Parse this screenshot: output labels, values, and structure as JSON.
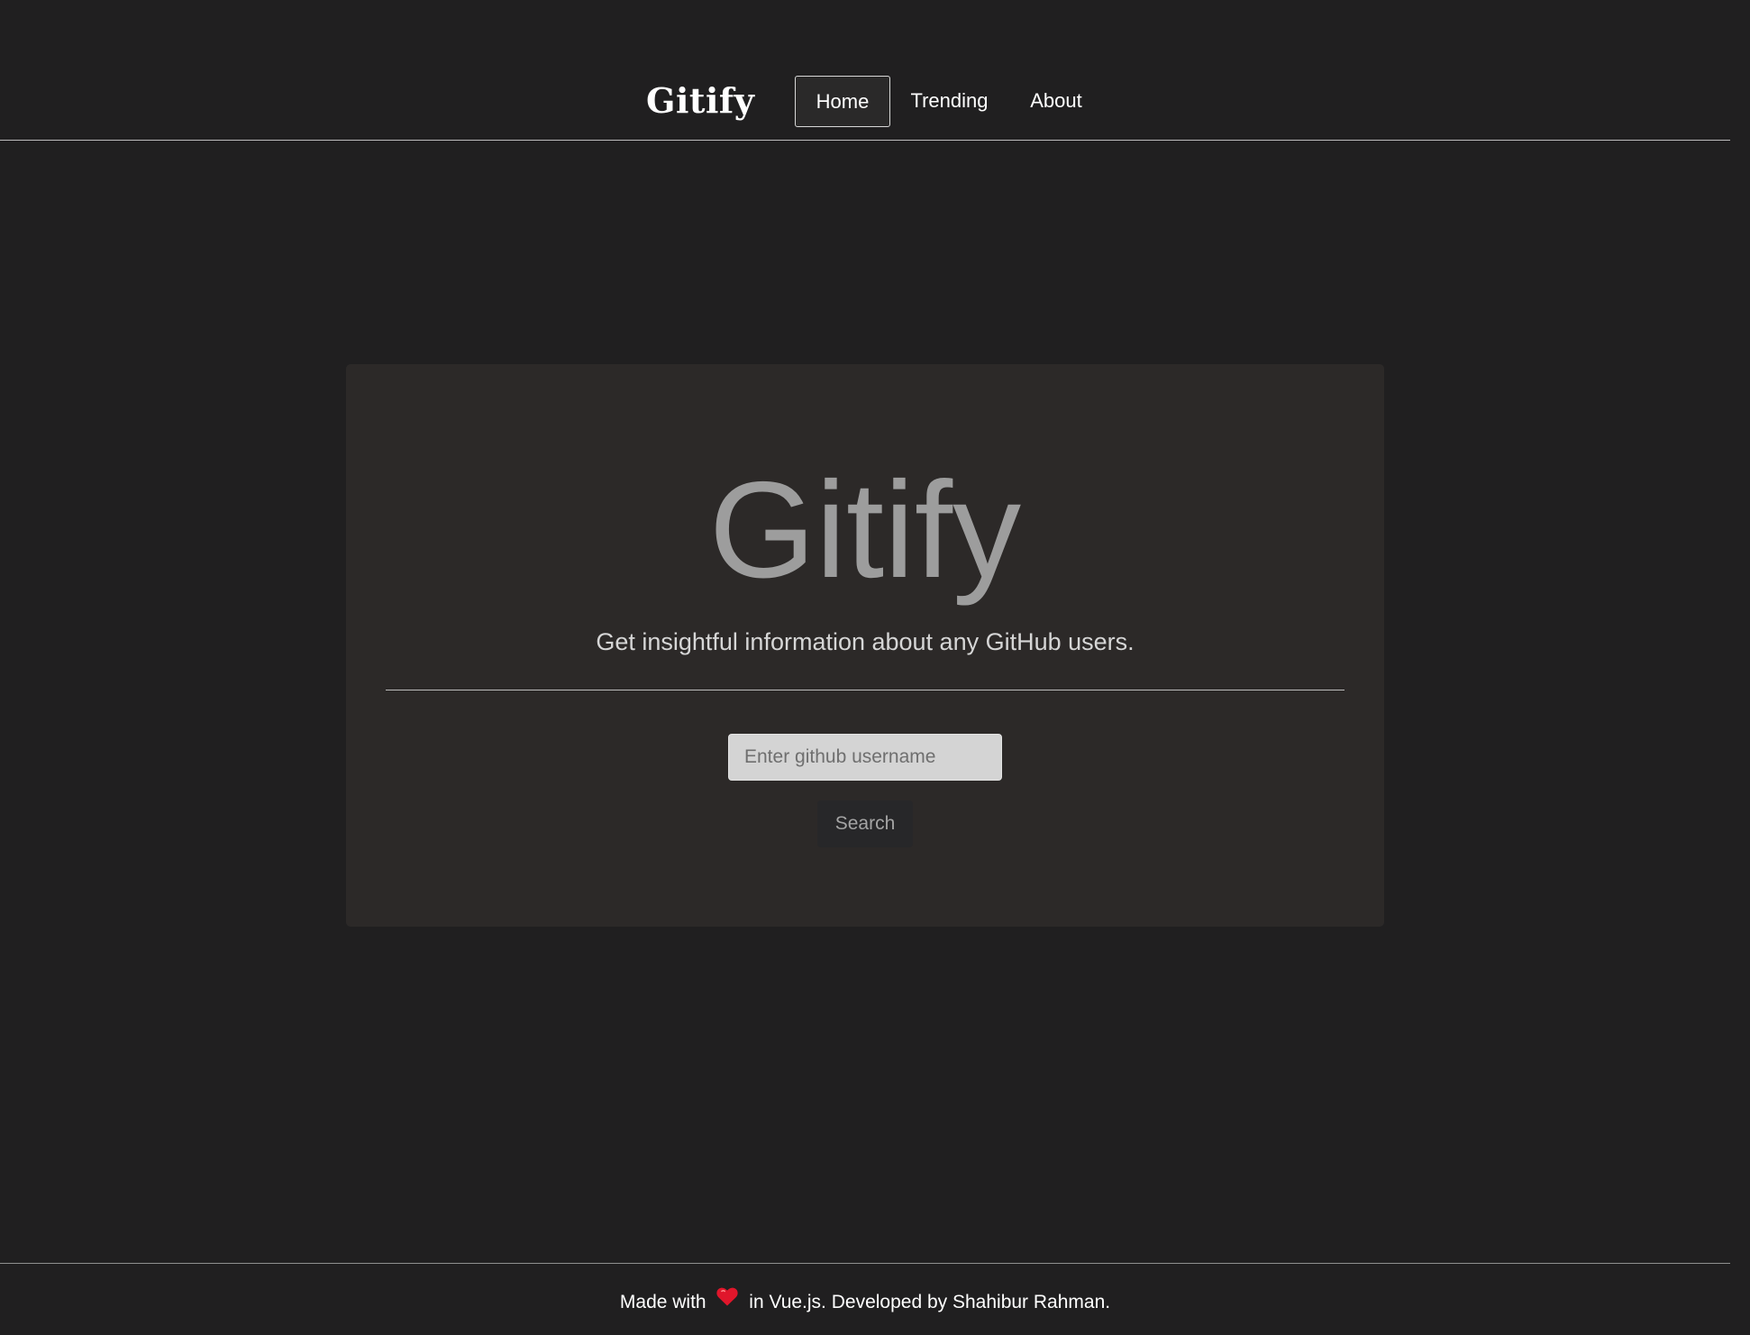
{
  "header": {
    "brand": "Gitify",
    "nav": {
      "home": "Home",
      "trending": "Trending",
      "about": "About"
    },
    "active_nav": "home"
  },
  "main": {
    "title": "Gitify",
    "lead": "Get insightful information about any GitHub users.",
    "search": {
      "placeholder": "Enter github username",
      "value": "",
      "button_label": "Search"
    }
  },
  "footer": {
    "text_before": "Made with",
    "heart_icon": "heart-icon",
    "text_after": "in Vue.js. Developed by Shahibur Rahman."
  },
  "colors": {
    "page_background": "#201f20",
    "card_background": "#2c2928",
    "heart": "#e0162b"
  }
}
